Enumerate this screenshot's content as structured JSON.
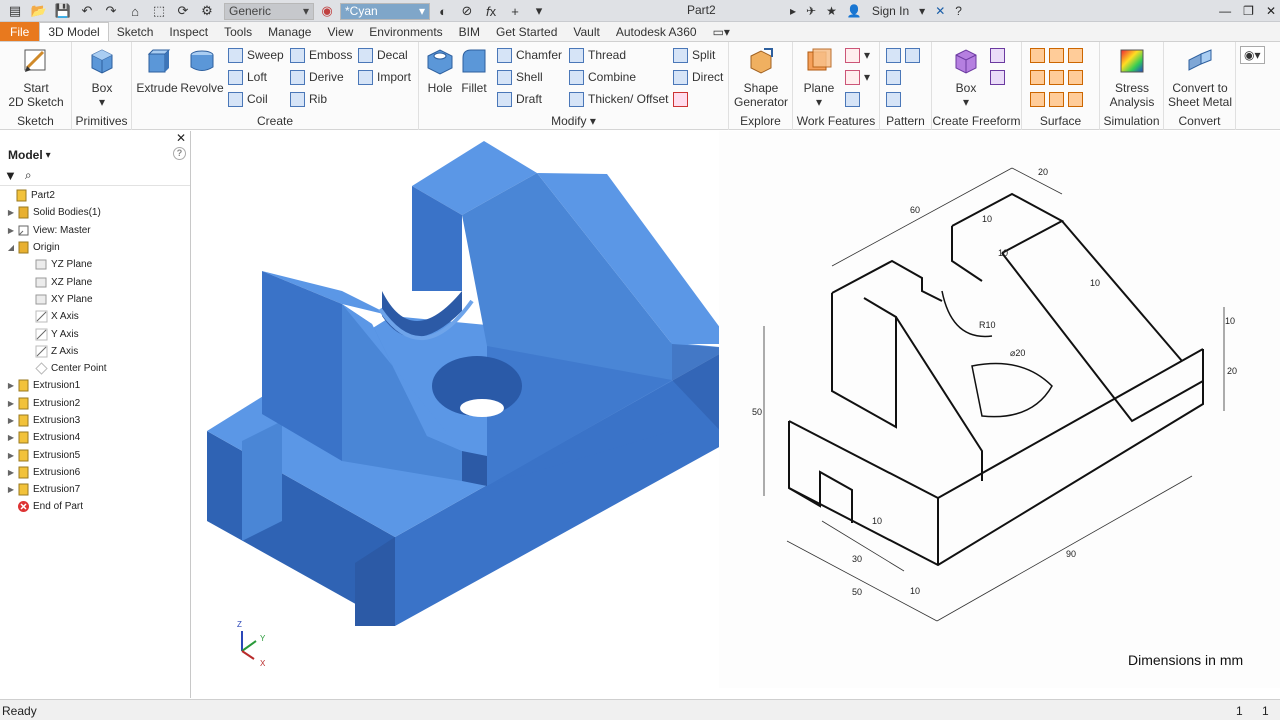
{
  "titlebar": {
    "material": "Generic",
    "appearance": "*Cyan",
    "doc_title": "Part2",
    "sign_in": "Sign In"
  },
  "tabs": [
    "File",
    "3D Model",
    "Sketch",
    "Inspect",
    "Tools",
    "Manage",
    "View",
    "Environments",
    "BIM",
    "Get Started",
    "Vault",
    "Autodesk A360"
  ],
  "ribbon": {
    "sketch": {
      "start_line1": "Start",
      "start_line2": "2D Sketch",
      "label": "Sketch"
    },
    "primitives": {
      "box": "Box",
      "label": "Primitives"
    },
    "create": {
      "extrude": "Extrude",
      "revolve": "Revolve",
      "sweep": "Sweep",
      "loft": "Loft",
      "coil": "Coil",
      "emboss": "Emboss",
      "derive": "Derive",
      "rib": "Rib",
      "decal": "Decal",
      "import": "Import",
      "label": "Create"
    },
    "modify": {
      "hole": "Hole",
      "fillet": "Fillet",
      "chamfer": "Chamfer",
      "shell": "Shell",
      "draft": "Draft",
      "thread": "Thread",
      "combine": "Combine",
      "thicken": "Thicken/ Offset",
      "split": "Split",
      "direct": "Direct",
      "label": "Modify"
    },
    "explore": {
      "line1": "Shape",
      "line2": "Generator",
      "label": "Explore"
    },
    "work": {
      "plane": "Plane",
      "label": "Work Features"
    },
    "pattern": {
      "label": "Pattern"
    },
    "freeform": {
      "box": "Box",
      "label": "Create Freeform"
    },
    "surface": {
      "label": "Surface"
    },
    "simulation": {
      "line1": "Stress",
      "line2": "Analysis",
      "label": "Simulation"
    },
    "convert": {
      "line1": "Convert to",
      "line2": "Sheet Metal",
      "label": "Convert"
    }
  },
  "browser": {
    "title": "Model",
    "items": [
      {
        "label": "Part2",
        "icon": "part-icon",
        "indent": 0,
        "exp": ""
      },
      {
        "label": "Solid Bodies(1)",
        "icon": "solid-bodies-icon",
        "indent": 1,
        "exp": "▶"
      },
      {
        "label": "View: Master",
        "icon": "view-icon",
        "indent": 1,
        "exp": "▶"
      },
      {
        "label": "Origin",
        "icon": "folder-icon",
        "indent": 1,
        "exp": "◢"
      },
      {
        "label": "YZ Plane",
        "icon": "plane-icon",
        "indent": 2,
        "exp": ""
      },
      {
        "label": "XZ Plane",
        "icon": "plane-icon",
        "indent": 2,
        "exp": ""
      },
      {
        "label": "XY Plane",
        "icon": "plane-icon",
        "indent": 2,
        "exp": ""
      },
      {
        "label": "X Axis",
        "icon": "axis-icon",
        "indent": 2,
        "exp": ""
      },
      {
        "label": "Y Axis",
        "icon": "axis-icon",
        "indent": 2,
        "exp": ""
      },
      {
        "label": "Z Axis",
        "icon": "axis-icon",
        "indent": 2,
        "exp": ""
      },
      {
        "label": "Center Point",
        "icon": "point-icon",
        "indent": 2,
        "exp": ""
      },
      {
        "label": "Extrusion1",
        "icon": "extrusion-icon",
        "indent": 1,
        "exp": "▶"
      },
      {
        "label": "Extrusion2",
        "icon": "extrusion-icon",
        "indent": 1,
        "exp": "▶"
      },
      {
        "label": "Extrusion3",
        "icon": "extrusion-icon",
        "indent": 1,
        "exp": "▶"
      },
      {
        "label": "Extrusion4",
        "icon": "extrusion-icon",
        "indent": 1,
        "exp": "▶"
      },
      {
        "label": "Extrusion5",
        "icon": "extrusion-icon",
        "indent": 1,
        "exp": "▶"
      },
      {
        "label": "Extrusion6",
        "icon": "extrusion-icon",
        "indent": 1,
        "exp": "▶"
      },
      {
        "label": "Extrusion7",
        "icon": "extrusion-icon",
        "indent": 1,
        "exp": "▶"
      },
      {
        "label": "End of Part",
        "icon": "end-of-part-icon",
        "indent": 1,
        "exp": ""
      }
    ]
  },
  "drawing": {
    "dims": {
      "d60": "60",
      "d20a": "20",
      "d10a": "10",
      "d10b": "10",
      "d10c": "10",
      "r10": "R10",
      "d10d": "10",
      "d20b": "20",
      "d20hole": "⌀20",
      "d50v": "50",
      "d10e": "10",
      "d30": "30",
      "d90": "90",
      "d50": "50",
      "d10f": "10"
    },
    "caption": "Dimensions in mm"
  },
  "triad": {
    "z": "Z",
    "y": "Y",
    "x": "X"
  },
  "status": {
    "text": "Ready",
    "count1": "1",
    "count2": "1"
  },
  "colors": {
    "model": "#4a86d6",
    "file_tab": "#e8791e"
  }
}
